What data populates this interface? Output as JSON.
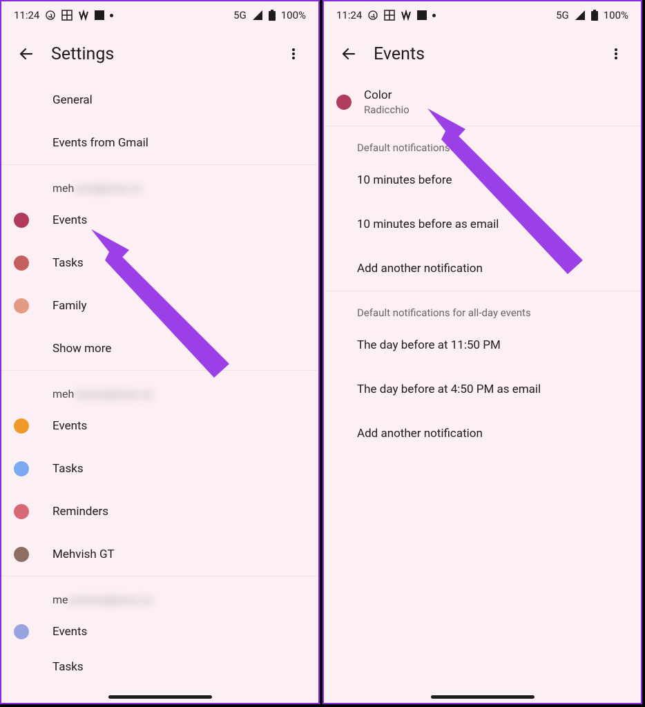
{
  "status": {
    "time": "11:24",
    "network": "5G",
    "battery": "100%"
  },
  "left": {
    "title": "Settings",
    "general": "General",
    "eventsFromGmail": "Events from Gmail",
    "account1": {
      "emailPrefix": "meh",
      "items": [
        {
          "label": "Events",
          "color": "#b23c5d"
        },
        {
          "label": "Tasks",
          "color": "#c56060"
        },
        {
          "label": "Family",
          "color": "#e49b85"
        }
      ],
      "showMore": "Show more"
    },
    "account2": {
      "emailPrefix": "meh",
      "items": [
        {
          "label": "Events",
          "color": "#f19a2b"
        },
        {
          "label": "Tasks",
          "color": "#7ba8f0"
        },
        {
          "label": "Reminders",
          "color": "#d76a74"
        },
        {
          "label": "Mehvish GT",
          "color": "#8d6f63"
        }
      ]
    },
    "account3": {
      "emailPrefix": "me",
      "items": [
        {
          "label": "Events",
          "color": "#99a3e0"
        },
        {
          "label": "Tasks",
          "color": ""
        }
      ]
    }
  },
  "right": {
    "title": "Events",
    "color": {
      "label": "Color",
      "value": "Radicchio",
      "swatch": "#b23c5d"
    },
    "section1": {
      "header": "Default notifications",
      "items": [
        "10 minutes before",
        "10 minutes before as email",
        "Add another notification"
      ]
    },
    "section2": {
      "header": "Default notifications for all-day events",
      "items": [
        "The day before at 11:50 PM",
        "The day before at 4:50 PM as email",
        "Add another notification"
      ]
    }
  },
  "colors": {
    "arrow": "#9b3fe6"
  }
}
